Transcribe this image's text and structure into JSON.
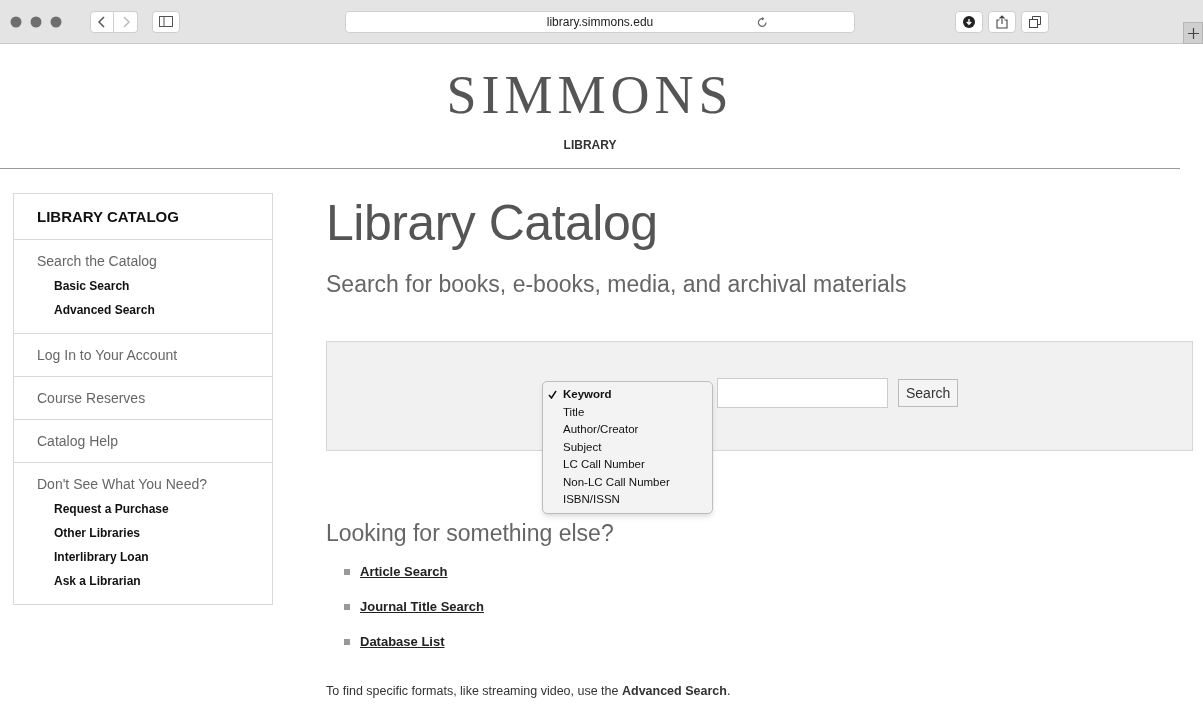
{
  "browser": {
    "address": "library.simmons.edu"
  },
  "header": {
    "logo": "SIMMONS",
    "sublogo": "LIBRARY"
  },
  "sidebar": {
    "title": "LIBRARY CATALOG",
    "sections": [
      {
        "label": "Search the Catalog",
        "children": [
          "Basic Search",
          "Advanced Search"
        ]
      },
      {
        "label": "Log In to Your Account"
      },
      {
        "label": "Course Reserves"
      },
      {
        "label": "Catalog Help"
      },
      {
        "label": "Don't See What You Need?",
        "children": [
          "Request a Purchase",
          "Other Libraries",
          "Interlibrary Loan",
          "Ask a Librarian"
        ]
      }
    ]
  },
  "main": {
    "heading": "Library Catalog",
    "subtitle": "Search for books, e-books, media, and archival materials",
    "search": {
      "options": [
        {
          "label": "Keyword",
          "selected": true
        },
        {
          "label": "Title",
          "selected": false
        },
        {
          "label": "Author/Creator",
          "selected": false
        },
        {
          "label": "Subject",
          "selected": false
        },
        {
          "label": "LC Call Number",
          "selected": false
        },
        {
          "label": "Non-LC Call Number",
          "selected": false
        },
        {
          "label": "ISBN/ISSN",
          "selected": false
        }
      ],
      "button": "Search"
    },
    "other_heading": "Looking for something else?",
    "links": [
      "Article Search",
      "Journal Title Search",
      "Database List"
    ],
    "note": "To find specific formats, like streaming video, use the **Advanced Search**."
  }
}
